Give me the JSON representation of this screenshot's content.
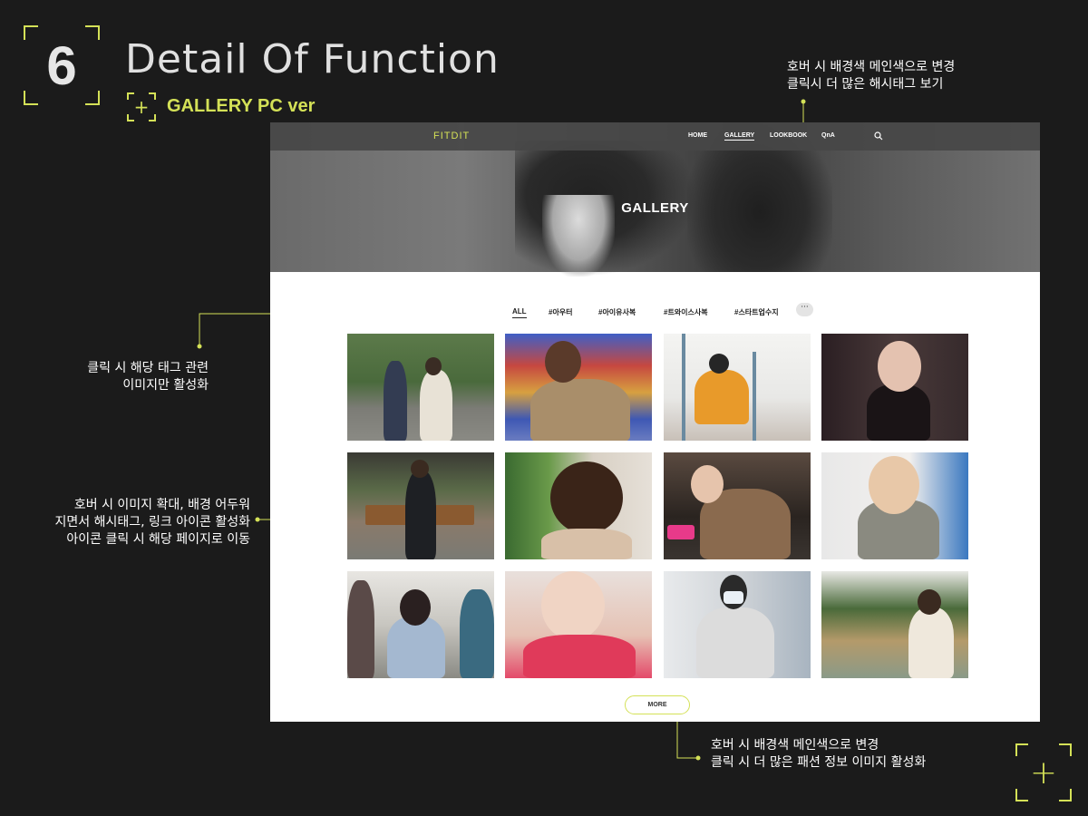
{
  "header": {
    "section_number": "6",
    "title": "Detail Of Function",
    "subtitle": "GALLERY PC ver"
  },
  "annotations": {
    "tag_more": [
      "호버 시 배경색 메인색으로 변경",
      "클릭시 더 많은 해시태그 보기"
    ],
    "tag_click": [
      "클릭 시 해당 태그 관련",
      "이미지만 활성화"
    ],
    "image_hover": [
      "호버 시 이미지 확대, 배경 어두워",
      "지면서 해시태그, 링크 아이콘 활성화",
      "아이콘 클릭 시 해당 페이지로 이동"
    ],
    "more_button": [
      "호버 시 배경색 메인색으로 변경",
      "클릭 시 더 많은 패션 정보 이미지 활성화"
    ]
  },
  "site": {
    "logo": "FITDIT",
    "nav": [
      "HOME",
      "GALLERY",
      "LOOKBOOK",
      "QnA"
    ],
    "active_nav": "GALLERY",
    "hero_title": "GALLERY",
    "tags": [
      "ALL",
      "#아우터",
      "#아이유사복",
      "#트와이스사복",
      "#스타트업수지"
    ],
    "active_tag": "ALL",
    "more_tags_label": "···",
    "more_button": "MORE"
  },
  "colors": {
    "accent": "#d4e157",
    "background": "#1b1b1b"
  }
}
